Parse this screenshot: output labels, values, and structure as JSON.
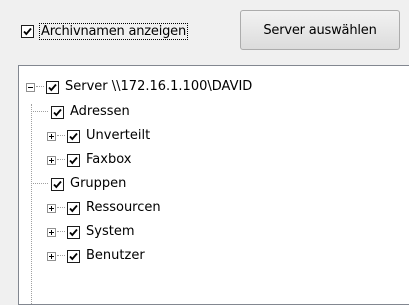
{
  "toolbar": {
    "show_archive_names_label": "Archivnamen anzeigen",
    "show_archive_names_checked": true,
    "select_server_label": "Server auswählen"
  },
  "tree": {
    "root": {
      "label": "Server \\\\172.16.1.100\\DAVID",
      "expanded": true,
      "checked": true
    },
    "children": [
      {
        "label": "Adressen",
        "checked": true,
        "expandable": false
      },
      {
        "label": "Unverteilt",
        "checked": true,
        "expandable": true
      },
      {
        "label": "Faxbox",
        "checked": true,
        "expandable": true
      },
      {
        "label": "Gruppen",
        "checked": true,
        "expandable": false
      },
      {
        "label": "Ressourcen",
        "checked": true,
        "expandable": true
      },
      {
        "label": "System",
        "checked": true,
        "expandable": true
      },
      {
        "label": "Benutzer",
        "checked": true,
        "expandable": true
      }
    ]
  }
}
